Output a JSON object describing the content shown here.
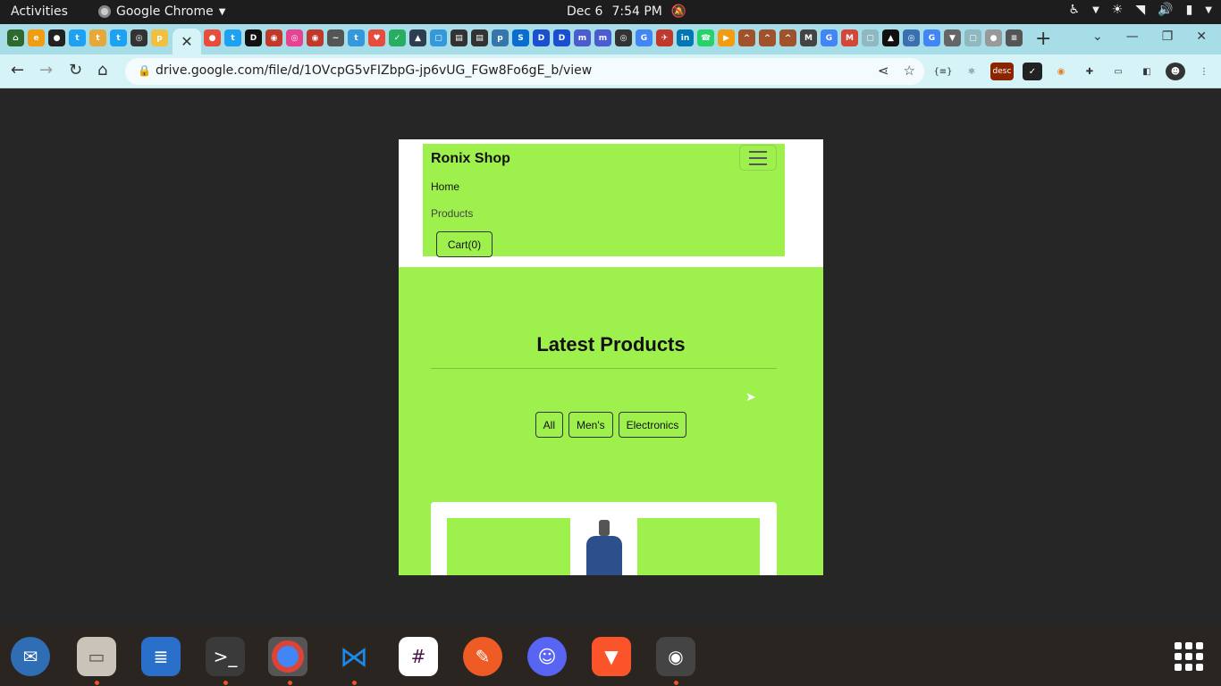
{
  "topbar": {
    "activities": "Activities",
    "app_name": "Google Chrome",
    "date": "Dec 6",
    "time": "7:54 PM"
  },
  "browser": {
    "url": "drive.google.com/file/d/1OVcpG5vFIZbpG-jp6vUG_FGw8Fo6gE_b/view",
    "ext_desc_label": "desc",
    "tab_favicons": [
      "tampermonkey-icon",
      "ecma-icon",
      "github-icon",
      "twitter-icon",
      "t-icon",
      "twitter-icon",
      "globe-icon",
      "python-icon"
    ],
    "tab_favicons_right": [
      "chat-icon",
      "twitter-icon",
      "dev-icon",
      "web-icon",
      "ring-icon",
      "web-icon",
      "wave-icon",
      "twitter-icon",
      "heart-icon",
      "bird-icon",
      "shield-icon",
      "tab-icon",
      "tab-icon",
      "tab-icon",
      "python-icon",
      "sap-icon",
      "d-icon",
      "d-icon",
      "m-icon",
      "m-icon",
      "globe-icon",
      "google-icon",
      "app-icon",
      "linkedin-icon",
      "whatsapp-icon",
      "tab-icon",
      "hat-icon",
      "hat-icon",
      "hat-icon",
      "mm-icon",
      "google-icon",
      "gmail-icon",
      "tab-icon",
      "aws-icon",
      "globe-icon",
      "google-icon",
      "tab-icon",
      "tab-icon",
      "tab-icon",
      "list-icon"
    ]
  },
  "page": {
    "brand": "Ronix Shop",
    "nav_home": "Home",
    "nav_products": "Products",
    "cart": "Cart(0)",
    "heading": "Latest Products",
    "filters": [
      "All",
      "Men's",
      "Electronics"
    ]
  },
  "colors": {
    "accent_green": "#9ef14c",
    "tab_strip": "#a7dde7",
    "toolbar": "#d6f4f8"
  }
}
